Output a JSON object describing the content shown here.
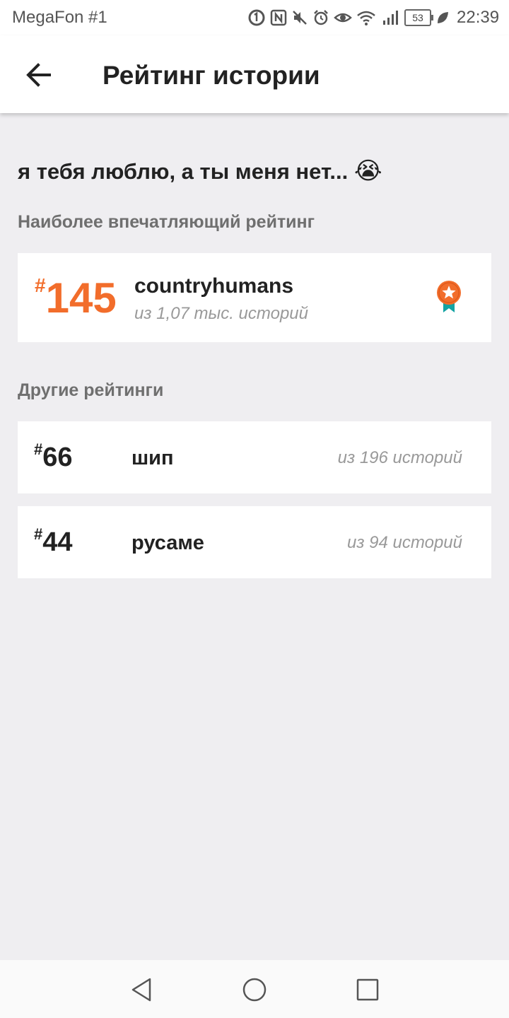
{
  "status_bar": {
    "carrier": "MegaFon #1",
    "battery": "53",
    "time": "22:39",
    "icons": [
      "data-saver-icon",
      "nfc-icon",
      "mute-icon",
      "alarm-icon",
      "eye-comfort-icon",
      "wifi-icon",
      "signal-icon",
      "battery-icon",
      "leaf-icon"
    ]
  },
  "app_bar": {
    "title": "Рейтинг истории",
    "back_icon": "arrow-left-icon"
  },
  "story": {
    "title": "я тебя люблю, а ты меня нет...",
    "emoji": "😭"
  },
  "top_section": {
    "label": "Наиболее впечатляющий рейтинг",
    "rank_hash": "#",
    "rank": "145",
    "category": "countryhumans",
    "subtitle": "из 1,07 тыс. историй",
    "accent_color": "#f26d2b",
    "badge_icon": "award-ribbon-icon"
  },
  "other_section": {
    "label": "Другие рейтинги",
    "items": [
      {
        "hash": "#",
        "rank": "66",
        "category": "шип",
        "count": "из 196 историй"
      },
      {
        "hash": "#",
        "rank": "44",
        "category": "русаме",
        "count": "из 94 историй"
      }
    ]
  },
  "nav_bar": {
    "icons": [
      "back-triangle-icon",
      "home-circle-icon",
      "recents-square-icon"
    ]
  }
}
